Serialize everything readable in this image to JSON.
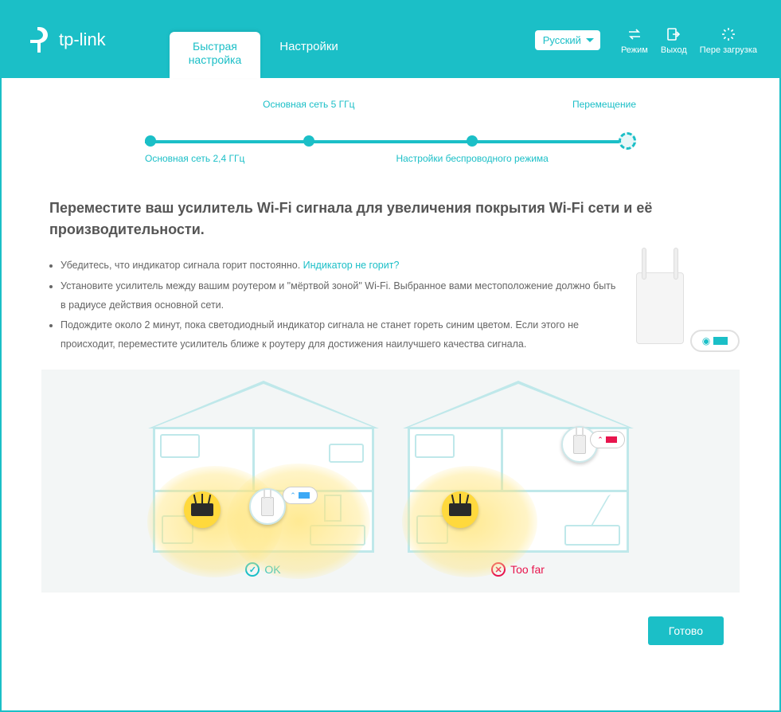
{
  "header": {
    "brand": "tp-link",
    "tabs": {
      "quick_setup_l1": "Быстрая",
      "quick_setup_l2": "настройка",
      "settings": "Настройки"
    },
    "language": "Русский",
    "buttons": {
      "mode": "Режим",
      "exit": "Выход",
      "reload": "Пере загрузка"
    }
  },
  "stepper": {
    "step1": "Основная сеть 2,4 ГГц",
    "step2": "Основная сеть 5 ГГц",
    "step3": "Настройки беспроводного режима",
    "step4": "Перемещение"
  },
  "main": {
    "title": "Переместите ваш усилитель Wi-Fi сигнала для увеличения покрытия Wi-Fi сети и её производительности.",
    "bullet1_a": "Убедитесь, что индикатор сигнала горит постоянно. ",
    "bullet1_link": "Индикатор не горит?",
    "bullet2": "Установите усилитель между вашим роутером и \"мёртвой зоной\" Wi-Fi. Выбранное вами местоположение должно быть в радиусе действия основной сети.",
    "bullet3": "Подождите около 2 минут, пока светодиодный индикатор сигнала не станет гореть синим цветом. Если этого не происходит, переместите усилитель ближе к роутеру для достижения наилучшего качества сигнала."
  },
  "diagram": {
    "ok_label": "OK",
    "too_far_label": "Too far"
  },
  "footer": {
    "done": "Готово"
  }
}
